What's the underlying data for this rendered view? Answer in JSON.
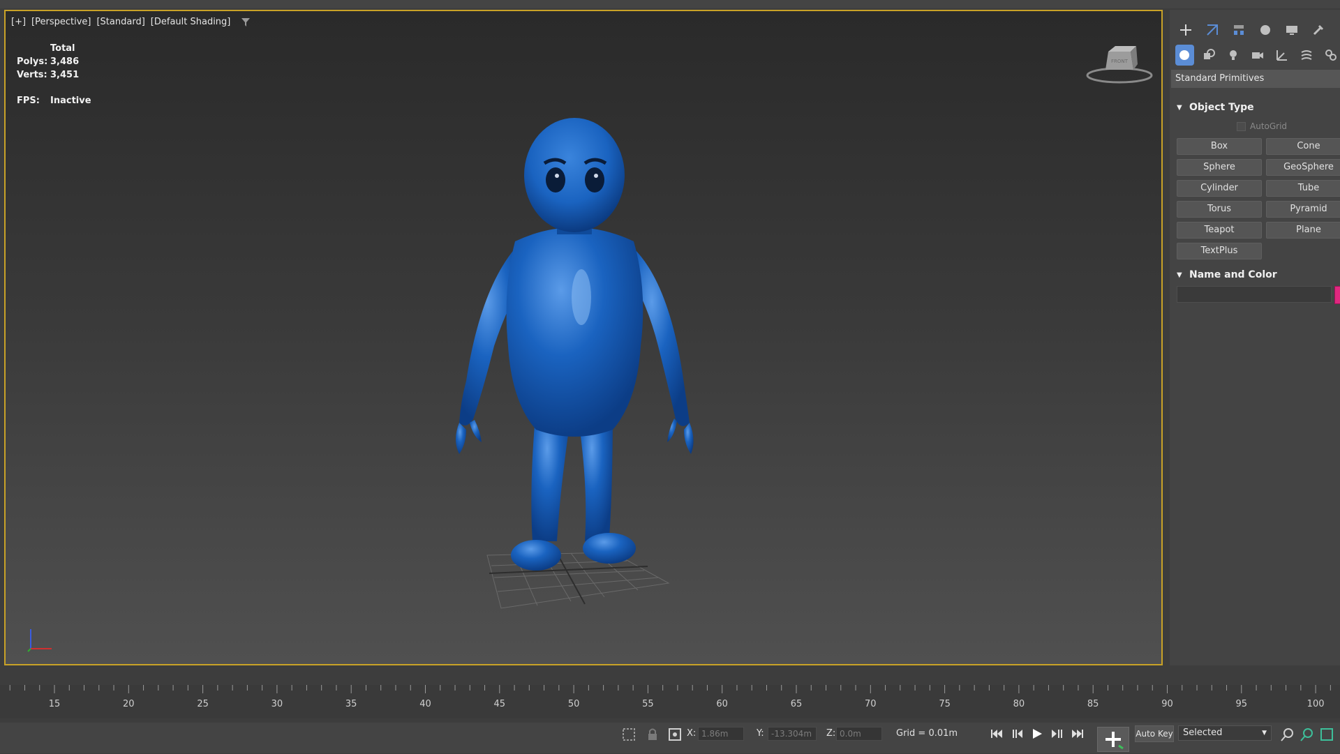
{
  "viewport": {
    "labels": [
      "[+]",
      "[Perspective]",
      "[Standard]",
      "[Default Shading]"
    ],
    "stats": {
      "total_label": "Total",
      "polys_label": "Polys:",
      "polys_value": "3,486",
      "verts_label": "Verts:",
      "verts_value": "3,451",
      "fps_label": "FPS:",
      "fps_value": "Inactive"
    },
    "navcube_label": "FRONT",
    "character_color": "#1a63c0",
    "border_color": "#c9a227"
  },
  "command_panel": {
    "category": "Standard Primitives",
    "object_type_title": "Object Type",
    "autogrid_label": "AutoGrid",
    "buttons": [
      "Box",
      "Cone",
      "Sphere",
      "GeoSphere",
      "Cylinder",
      "Tube",
      "Torus",
      "Pyramid",
      "Teapot",
      "Plane",
      "TextPlus"
    ],
    "name_color_title": "Name and Color",
    "object_color": "#e0287f"
  },
  "timeline": {
    "ticks": [
      "15",
      "20",
      "25",
      "30",
      "35",
      "40",
      "45",
      "50",
      "55",
      "60",
      "65",
      "70",
      "75",
      "80",
      "85",
      "90",
      "95",
      "100"
    ]
  },
  "status": {
    "x_label": "X:",
    "x_value": "1.86m",
    "y_label": "Y:",
    "y_value": "-13.304m",
    "z_label": "Z:",
    "z_value": "0.0m",
    "grid": "Grid = 0.01m",
    "auto_key": "Auto Key",
    "selected": "Selected"
  }
}
